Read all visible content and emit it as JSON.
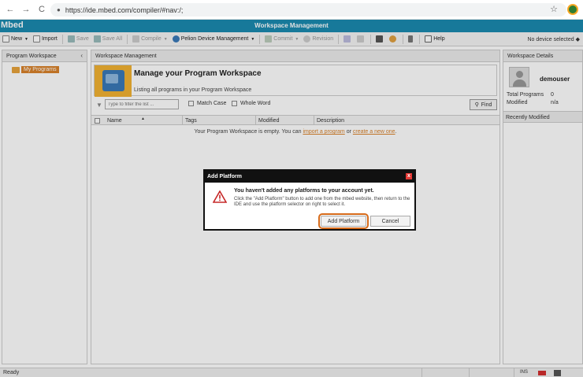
{
  "browser": {
    "url": "https://ide.mbed.com/compiler/#nav:/;",
    "back": "←",
    "forward": "→",
    "reload": "C"
  },
  "app": {
    "brand": "Mbed",
    "title": "Workspace Management"
  },
  "toolbar": {
    "new": "New",
    "import": "Import",
    "save": "Save",
    "save_all": "Save All",
    "compile": "Compile",
    "device_mgmt": "Pelion Device Management",
    "commit": "Commit",
    "revision": "Revision",
    "help": "Help",
    "device_selected": "No device selected"
  },
  "left_panel": {
    "header": "Program Workspace",
    "collapse": "‹",
    "tree_item": "My Programs"
  },
  "main": {
    "header": "Workspace Management",
    "card_title": "Manage your Program Workspace",
    "card_subtitle": "Listing all programs in your Program Workspace",
    "filter_placeholder": "Type to filter the list ...",
    "match_case": "Match Case",
    "whole_word": "Whole Word",
    "find": "Find",
    "columns": [
      "Name",
      "Tags",
      "Modified",
      "Description"
    ],
    "empty_prefix": "Your Program Workspace is empty. You can ",
    "empty_link1": "import a program",
    "empty_or": " or ",
    "empty_link2": "create a new one",
    "empty_suffix": "."
  },
  "right_panel": {
    "header": "Workspace Details",
    "username": "demouser",
    "total_label": "Total Programs",
    "total_value": "0",
    "modified_label": "Modified",
    "modified_value": "n/a",
    "recent_header": "Recently Modified"
  },
  "dialog": {
    "title": "Add Platform",
    "close": "x",
    "heading": "You haven't added any platforms to your account yet.",
    "body": "Click the \"Add Platform\" button to add one from the mbed website, then return to the IDE and use the platform selector on right to select it.",
    "primary": "Add Platform",
    "secondary": "Cancel"
  },
  "status": {
    "text": "Ready",
    "ins": "INS"
  },
  "colors": {
    "titlebar": "#1b8ab0",
    "accent": "#d9822b",
    "highlight": "#d66a1a"
  }
}
